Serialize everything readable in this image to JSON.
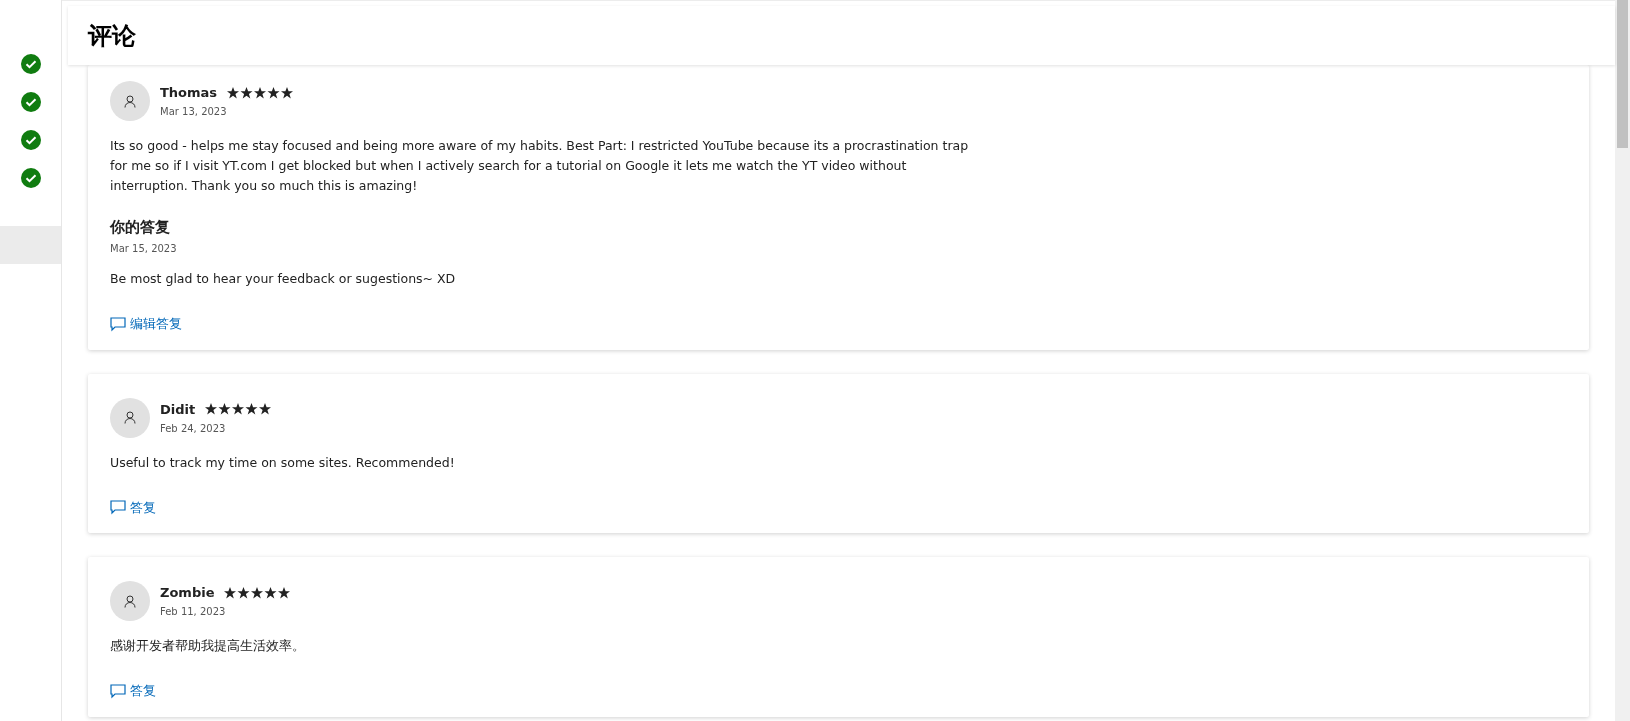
{
  "sidebar": {
    "steps": [
      {
        "done": true
      },
      {
        "done": true
      },
      {
        "done": true
      },
      {
        "done": true
      }
    ]
  },
  "header": {
    "title": "评论"
  },
  "reviews": [
    {
      "author": "Thomas",
      "stars": 5,
      "date": "Mar 13, 2023",
      "text": "Its so good - helps me stay focused and being more aware of my habits. Best Part: I restricted YouTube because its a procrastination trap for me so if I visit YT.com I get blocked but when I actively search for a tutorial on Google it lets me watch the YT video without interruption. Thank you so much this is amazing!",
      "reply": {
        "title": "你的答复",
        "date": "Mar 15, 2023",
        "text": "Be most glad to hear your feedback or sugestions~ XD"
      },
      "action": "编辑答复"
    },
    {
      "author": "Didit",
      "stars": 5,
      "date": "Feb 24, 2023",
      "text": "Useful to track my time on some sites. Recommended!",
      "action": "答复"
    },
    {
      "author": "Zombie",
      "stars": 5,
      "date": "Feb 11, 2023",
      "text": "感谢开发者帮助我提高生活效率。",
      "action": "答复"
    }
  ]
}
